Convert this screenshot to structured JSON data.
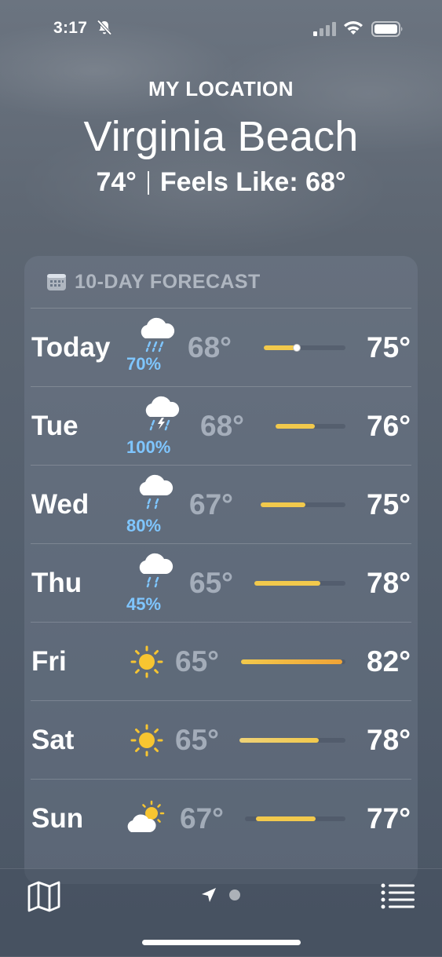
{
  "status": {
    "time": "3:17"
  },
  "header": {
    "location_label": "MY LOCATION",
    "city": "Virginia Beach",
    "current_temp": "74°",
    "feels_like": "Feels Like: 68°"
  },
  "forecast": {
    "title": "10-DAY FORECAST",
    "days": [
      {
        "day": "Today",
        "icon": "cloud-rain-icon",
        "precip": "70%",
        "low": "68°",
        "high": "75°"
      },
      {
        "day": "Tue",
        "icon": "cloud-bolt-rain-icon",
        "precip": "100%",
        "low": "68°",
        "high": "76°"
      },
      {
        "day": "Wed",
        "icon": "cloud-rain-icon",
        "precip": "80%",
        "low": "67°",
        "high": "75°"
      },
      {
        "day": "Thu",
        "icon": "cloud-rain-icon",
        "precip": "45%",
        "low": "65°",
        "high": "78°"
      },
      {
        "day": "Fri",
        "icon": "sun-icon",
        "precip": "",
        "low": "65°",
        "high": "82°"
      },
      {
        "day": "Sat",
        "icon": "sun-icon",
        "precip": "",
        "low": "65°",
        "high": "78°"
      },
      {
        "day": "Sun",
        "icon": "partly-cloudy-icon",
        "precip": "",
        "low": "67°",
        "high": "77°"
      }
    ]
  },
  "tabbar": {
    "map_icon": "map-icon",
    "location_icon": "location-arrow-icon",
    "list_icon": "list-icon"
  },
  "colors": {
    "precip": "#7fc6ff",
    "bar_yellow": "#f2c94c",
    "bar_orange": "#f0a336"
  }
}
